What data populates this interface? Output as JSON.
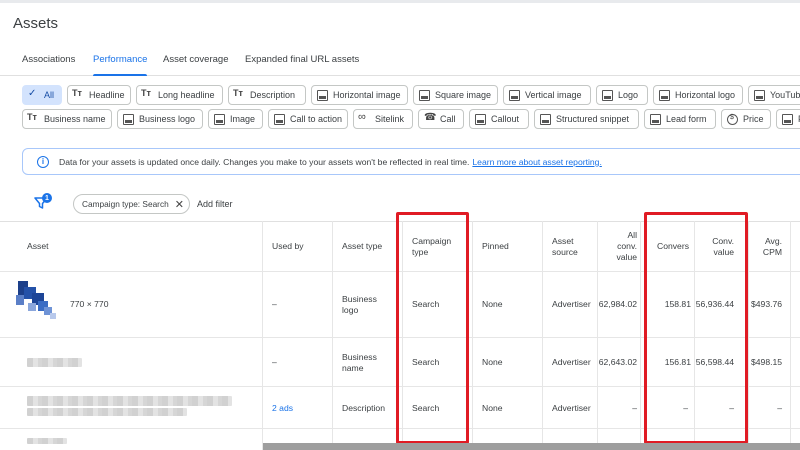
{
  "page": {
    "title": "Assets"
  },
  "tabs": [
    "Associations",
    "Performance",
    "Asset coverage",
    "Expanded final URL assets"
  ],
  "chips_row1": [
    "All",
    "Headline",
    "Long headline",
    "Description",
    "Horizontal image",
    "Square image",
    "Vertical image",
    "Logo",
    "Horizontal logo",
    "YouTube"
  ],
  "chips_row2": [
    "Business name",
    "Business logo",
    "Image",
    "Call to action",
    "Sitelink",
    "Call",
    "Callout",
    "Structured snippet",
    "Lead form",
    "Price",
    "P"
  ],
  "banner": {
    "text": "Data for your assets is updated once daily. Changes you make to your assets won't be reflected in real time.",
    "link": "Learn more about asset reporting."
  },
  "filters": {
    "badge": "1",
    "active_filter": "Campaign type: Search",
    "add_filter": "Add filter"
  },
  "table": {
    "headers": {
      "asset": "Asset",
      "used_by": "Used by",
      "asset_type": "Asset type",
      "campaign_type": [
        "Campaign",
        "type"
      ],
      "pinned": "Pinned",
      "asset_source": [
        "Asset",
        "source"
      ],
      "all_conv_value": [
        "All",
        "conv.",
        "value"
      ],
      "conversions": "Convers",
      "conv_value": [
        "Conv.",
        "value"
      ],
      "avg_cpm": [
        "Avg.",
        "CPM"
      ]
    },
    "rows": [
      {
        "asset": "770 × 770",
        "used_by": "–",
        "asset_type": [
          "Business",
          "logo"
        ],
        "campaign_type": "Search",
        "pinned": "None",
        "asset_source": "Advertiser",
        "all_conv_value": "62,984.02",
        "conversions": "158.81",
        "conv_value": "56,936.44",
        "avg_cpm": "$493.76"
      },
      {
        "asset": "",
        "used_by": "–",
        "asset_type": [
          "Business",
          "name"
        ],
        "campaign_type": "Search",
        "pinned": "None",
        "asset_source": "Advertiser",
        "all_conv_value": "62,643.02",
        "conversions": "156.81",
        "conv_value": "56,598.44",
        "avg_cpm": "$498.15"
      },
      {
        "asset": "",
        "used_by": "2 ads",
        "asset_type": [
          "Description"
        ],
        "campaign_type": "Search",
        "pinned": "None",
        "asset_source": "Advertiser",
        "all_conv_value": "–",
        "conversions": "–",
        "conv_value": "–",
        "avg_cpm": "–"
      }
    ]
  },
  "colors": {
    "accent": "#1a73e8",
    "highlight": "#e01b24",
    "selected_chip": "#d3e3fd"
  }
}
